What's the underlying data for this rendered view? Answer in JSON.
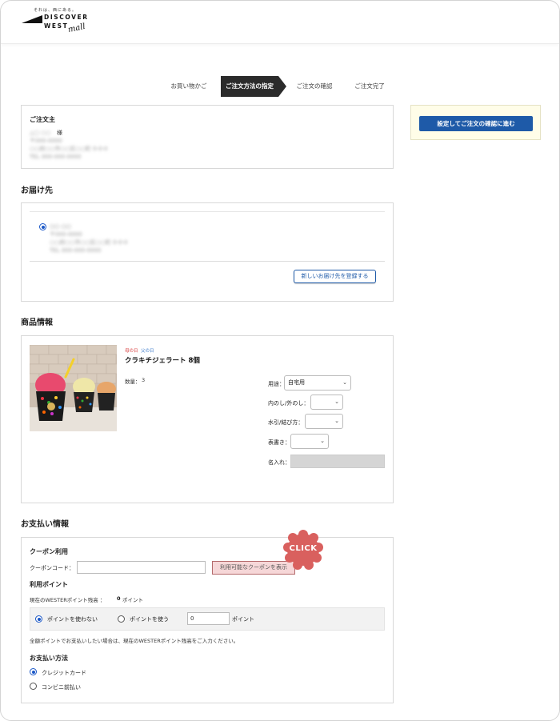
{
  "header": {
    "logo_tagline": "それは、西にある。",
    "logo_word1": "DISCOVER",
    "logo_word2": "WEST",
    "logo_word3": "mall"
  },
  "steps": [
    {
      "label": "お買い物かご",
      "active": false
    },
    {
      "label": "ご注文方法の指定",
      "active": true
    },
    {
      "label": "ご注文の確認",
      "active": false
    },
    {
      "label": "ご注文完了",
      "active": false
    }
  ],
  "side": {
    "confirm_button": "設定してご注文の確認に進む"
  },
  "orderer": {
    "title": "ご注文主",
    "name": "△□ ○○",
    "honorific": "様",
    "details": "〒000-0000\n○○府○○市○○区○○町 0-0-0\nTEL 000-000-0000"
  },
  "delivery": {
    "title": "お届け先",
    "name": "○○ ○○",
    "details": "〒000-0000\n○○府○○市○○区○○町 0-0-0\nTEL 000-000-0000",
    "new_address_button": "新しいお届け先を登録する"
  },
  "product_info": {
    "title": "商品情報",
    "tags": [
      "母の日",
      "父の日"
    ],
    "name": "クラキチジェラート 8個",
    "quantity_label": "数量：",
    "quantity": "3",
    "fields": [
      {
        "label": "用途：",
        "value": "自宅用"
      },
      {
        "label": "内のし/外のし：",
        "value": ""
      },
      {
        "label": "水引/結び方：",
        "value": ""
      },
      {
        "label": "表書き：",
        "value": ""
      },
      {
        "label": "名入れ：",
        "value": ""
      }
    ]
  },
  "payment": {
    "title": "お支払い情報",
    "coupon_title": "クーポン利用",
    "coupon_label": "クーポンコード：",
    "coupon_value": "",
    "coupon_button": "利用可能なクーポンを表示",
    "points_title": "利用ポイント",
    "points_balance_text": "現在のWESTERポイント残高 ：",
    "points_balance_value": "0",
    "points_unit": "ポイント",
    "points_option_no": "ポイントを使わない",
    "points_option_yes": "ポイントを使う",
    "points_input_value": "0",
    "points_note": "全額ポイントでお支払いしたい場合は、現在のWESTERポイント残高をご入力ください。",
    "method_title": "お支払い方法",
    "methods": [
      {
        "label": "クレジットカード",
        "selected": true
      },
      {
        "label": "コンビニ前払い",
        "selected": false
      }
    ]
  },
  "badge": {
    "text": "CLICK",
    "color": "#d9605e"
  },
  "colors": {
    "accent_blue": "#1e5aa8",
    "tag_red": "#d83a3a",
    "tag_blue": "#3b79c9",
    "side_bg": "#fffde8",
    "coupon_btn_bg": "#f6d7d8"
  }
}
